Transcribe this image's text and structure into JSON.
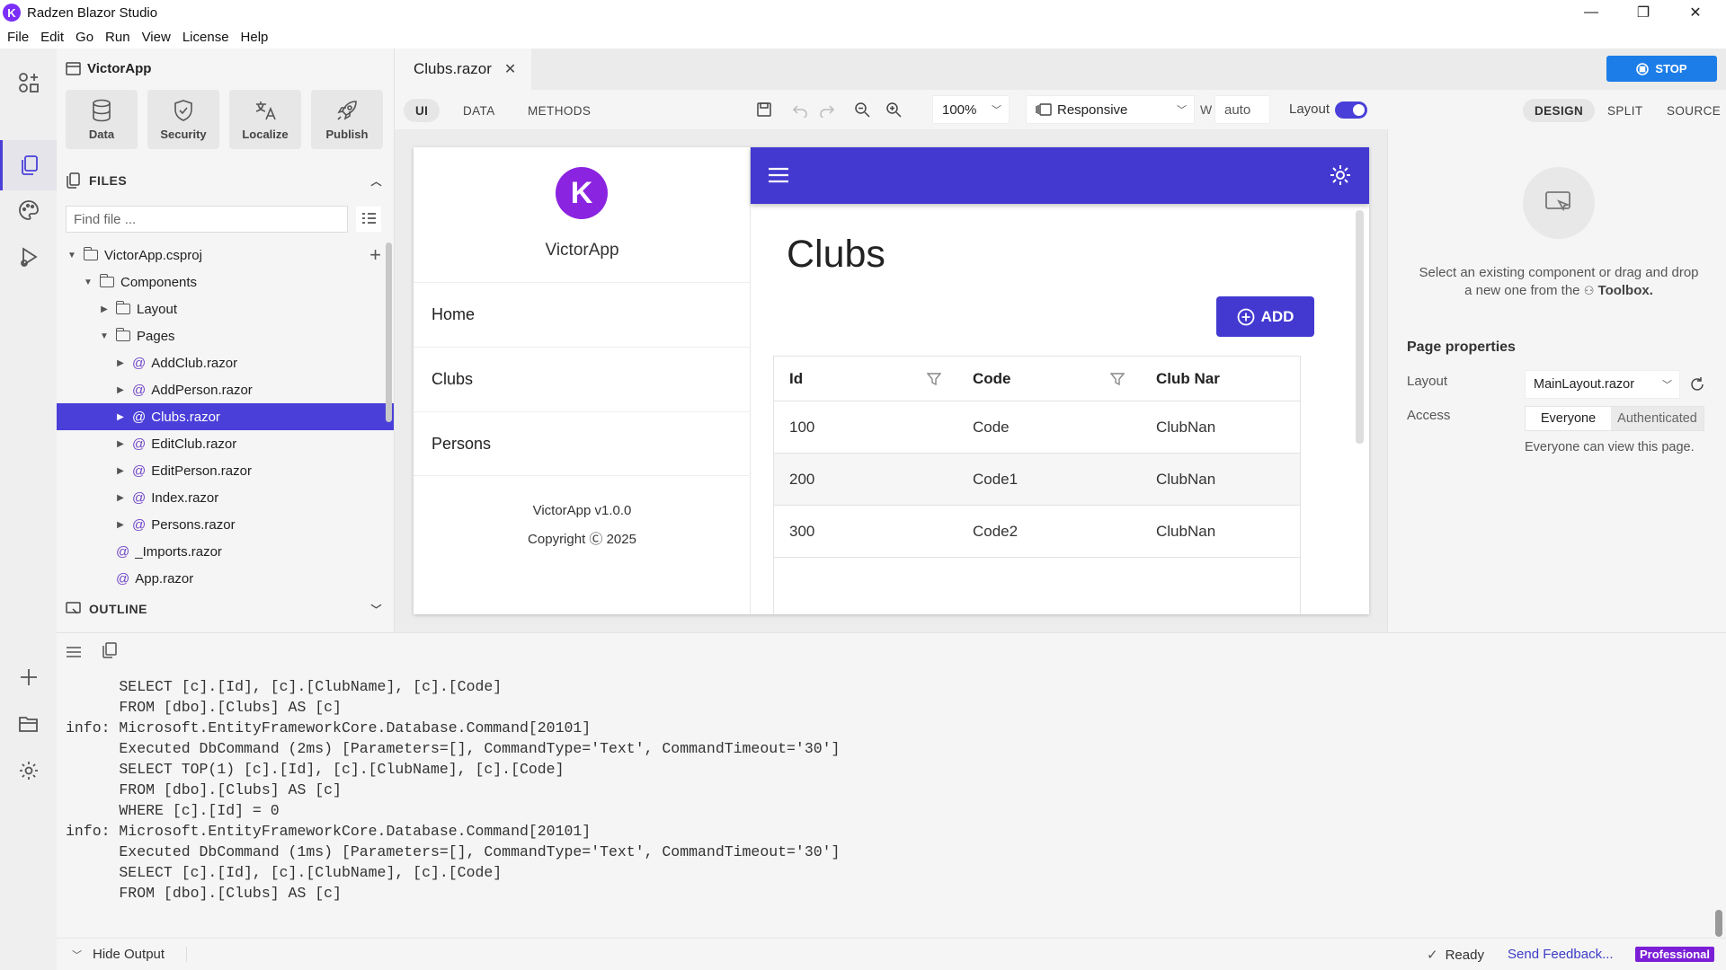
{
  "window": {
    "title": "Radzen Blazor Studio",
    "minimize": "—",
    "maximize": "❐",
    "close": "✕"
  },
  "menu": [
    "File",
    "Edit",
    "Go",
    "Run",
    "View",
    "License",
    "Help"
  ],
  "project": {
    "name": "VictorApp",
    "tools": [
      {
        "label": "Data",
        "icon": "database-icon"
      },
      {
        "label": "Security",
        "icon": "shield-icon"
      },
      {
        "label": "Localize",
        "icon": "translate-icon"
      },
      {
        "label": "Publish",
        "icon": "rocket-icon"
      }
    ]
  },
  "files": {
    "header": "FILES",
    "search_placeholder": "Find file ...",
    "tree": [
      {
        "label": "VictorApp.csproj",
        "type": "folder",
        "depth": 0,
        "expanded": true
      },
      {
        "label": "Components",
        "type": "folder",
        "depth": 1,
        "expanded": true
      },
      {
        "label": "Layout",
        "type": "folder",
        "depth": 2,
        "expanded": false
      },
      {
        "label": "Pages",
        "type": "folder",
        "depth": 2,
        "expanded": true
      },
      {
        "label": "AddClub.razor",
        "type": "razor",
        "depth": 3
      },
      {
        "label": "AddPerson.razor",
        "type": "razor",
        "depth": 3
      },
      {
        "label": "Clubs.razor",
        "type": "razor",
        "depth": 3,
        "selected": true
      },
      {
        "label": "EditClub.razor",
        "type": "razor",
        "depth": 3
      },
      {
        "label": "EditPerson.razor",
        "type": "razor",
        "depth": 3
      },
      {
        "label": "Index.razor",
        "type": "razor",
        "depth": 3
      },
      {
        "label": "Persons.razor",
        "type": "razor",
        "depth": 3
      },
      {
        "label": "_Imports.razor",
        "type": "razor",
        "depth": 2,
        "leaf": true
      },
      {
        "label": "App.razor",
        "type": "razor",
        "depth": 2,
        "leaf": true
      }
    ]
  },
  "outline": {
    "header": "OUTLINE"
  },
  "editor": {
    "tab": "Clubs.razor",
    "stop_label": "STOP",
    "modes": [
      "UI",
      "DATA",
      "METHODS"
    ],
    "zoom": "100%",
    "device": "Responsive",
    "width_label": "W",
    "width_value": "auto",
    "layout_label": "Layout",
    "layout_on": true,
    "views": [
      "DESIGN",
      "SPLIT",
      "SOURCE"
    ],
    "active_view": "DESIGN"
  },
  "preview": {
    "app_name": "VictorApp",
    "nav": [
      "Home",
      "Clubs",
      "Persons"
    ],
    "version": "VictorApp v1.0.0",
    "copyright": "Copyright Ⓒ 2025",
    "page_title": "Clubs",
    "add_label": "ADD",
    "grid": {
      "columns": [
        "Id",
        "Code",
        "Club Nar"
      ],
      "rows": [
        [
          "100",
          "Code",
          "ClubNan"
        ],
        [
          "200",
          "Code1",
          "ClubNan"
        ],
        [
          "300",
          "Code2",
          "ClubNan"
        ]
      ]
    }
  },
  "properties": {
    "hint_line1": "Select an existing component or drag and drop",
    "hint_line2": "a new one from the",
    "hint_toolbox": "Toolbox.",
    "title": "Page properties",
    "layout_label": "Layout",
    "layout_value": "MainLayout.razor",
    "access_label": "Access",
    "access_options": [
      "Everyone",
      "Authenticated"
    ],
    "access_selected": "Everyone",
    "access_note": "Everyone can view this page."
  },
  "output": {
    "lines": [
      "      SELECT [c].[Id], [c].[ClubName], [c].[Code]",
      "      FROM [dbo].[Clubs] AS [c]",
      "info: Microsoft.EntityFrameworkCore.Database.Command[20101]",
      "      Executed DbCommand (2ms) [Parameters=[], CommandType='Text', CommandTimeout='30']",
      "      SELECT TOP(1) [c].[Id], [c].[ClubName], [c].[Code]",
      "      FROM [dbo].[Clubs] AS [c]",
      "      WHERE [c].[Id] = 0",
      "info: Microsoft.EntityFrameworkCore.Database.Command[20101]",
      "      Executed DbCommand (1ms) [Parameters=[], CommandType='Text', CommandTimeout='30']",
      "      SELECT [c].[Id], [c].[ClubName], [c].[Code]",
      "      FROM [dbo].[Clubs] AS [c]"
    ]
  },
  "status": {
    "hide_output": "Hide Output",
    "ready": "Ready",
    "feedback": "Send Feedback...",
    "edition": "Professional"
  },
  "colors": {
    "accent": "#4a3fd9",
    "brand": "#8a24e0",
    "stop": "#1c7de8"
  }
}
